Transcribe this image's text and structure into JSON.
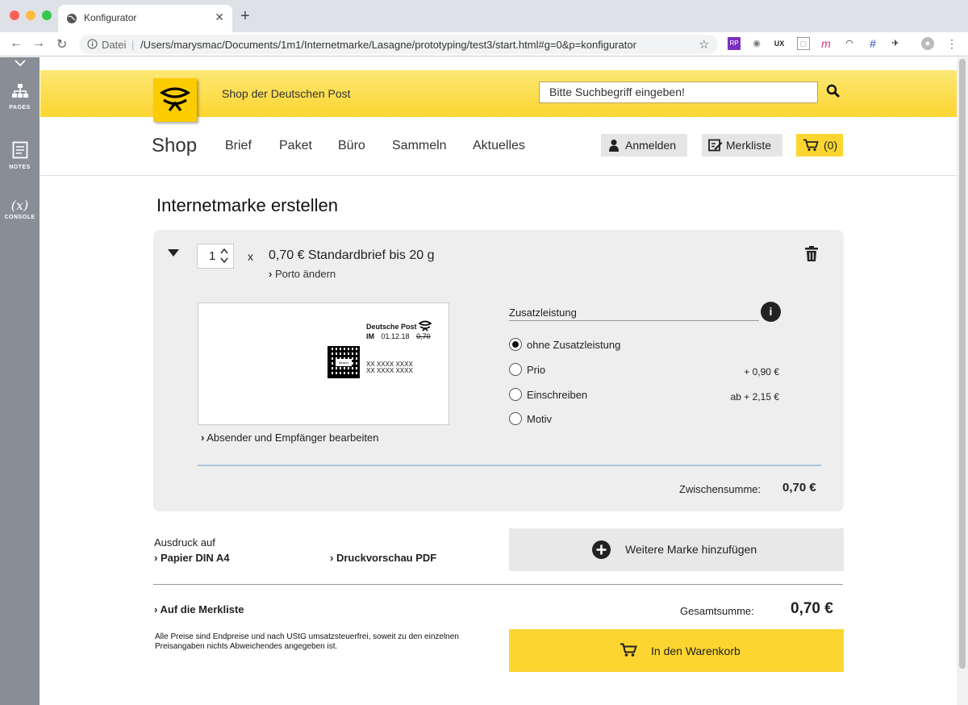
{
  "browser": {
    "tab_title": "Konfigurator",
    "new_tab": "+",
    "tab_close": "✕",
    "omnibox_info": "Datei",
    "url": "/Users/marysmac/Documents/1m1/Internetmarke/Lasagne/prototyping/test3/start.html#g=0&p=konfigurator",
    "ext_badge_ux": "UX",
    "ext_badge_m": "m",
    "ext_badge_rp": "RP"
  },
  "tool_panel": {
    "items": [
      {
        "label": "PAGES"
      },
      {
        "label": "NOTES"
      },
      {
        "label": "CONSOLE",
        "symbol": "(x)"
      }
    ]
  },
  "header": {
    "shop_name": "Shop der Deutschen Post",
    "search_placeholder": "Bitte Suchbegriff eingeben!",
    "brand": "Shop",
    "nav": [
      "Brief",
      "Paket",
      "Büro",
      "Sammeln",
      "Aktuelles"
    ],
    "login": "Anmelden",
    "wishlist": "Merkliste",
    "cart": "(0)"
  },
  "page": {
    "title": "Internetmarke erstellen",
    "item": {
      "quantity": "1",
      "times": "x",
      "product": "0,70 € Standardbrief bis 20 g",
      "change_postage": "Porto ändern",
      "preview": {
        "brand": "Deutsche Post",
        "im_prefix": "IM",
        "date": "01.12.18",
        "value": "0,70",
        "muster": "Muster",
        "code_line1": "XX XXXX XXXX",
        "code_line2": "XX XXXX XXXX"
      },
      "edit_addresses": "Absender und Empfänger bearbeiten",
      "addon_title": "Zusatzleistung",
      "info_symbol": "i",
      "options": [
        {
          "label": "ohne Zusatzleistung",
          "price": "",
          "selected": true
        },
        {
          "label": "Prio",
          "price": "+ 0,90 €",
          "selected": false
        },
        {
          "label": "Einschreiben",
          "price": "ab + 2,15 €",
          "selected": false
        },
        {
          "label": "Motiv",
          "price": "",
          "selected": false
        }
      ],
      "subtotal_label": "Zwischensumme:",
      "subtotal": "0,70 €"
    },
    "print_label": "Ausdruck auf",
    "print_paper": "Papier DIN A4",
    "print_preview": "Druckvorschau PDF",
    "add_stamp": "Weitere Marke hinzufügen",
    "to_wishlist": "Auf die Merkliste",
    "total_label": "Gesamtsumme:",
    "total": "0,70 €",
    "disclaimer": "Alle Preise sind Endpreise und nach UStG umsatzsteuerfrei, soweit zu den einzelnen Preisangaben nichts Abweichendes angegeben ist.",
    "add_to_cart": "In den Warenkorb"
  },
  "colors": {
    "brand_yellow": "#fcd530",
    "panel_gray": "#888d96"
  }
}
